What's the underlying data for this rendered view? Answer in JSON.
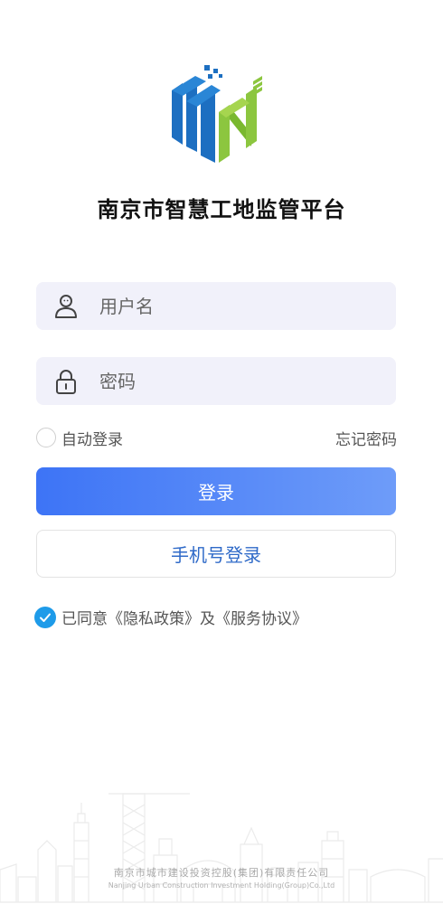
{
  "app": {
    "title": "南京市智慧工地监管平台"
  },
  "form": {
    "username_placeholder": "用户名",
    "password_placeholder": "密码",
    "remember_label": "自动登录",
    "forgot_label": "忘记密码",
    "login_label": "登录",
    "phone_login_label": "手机号登录"
  },
  "agreement": {
    "text": "已同意《隐私政策》及《服务协议》",
    "checked": true
  },
  "footer": {
    "company_cn": "南京市城市建设投资控股(集团)有限责任公司",
    "company_en": "Nanjing Urban Construction Investment Holding(Group)Co.,Ltd"
  },
  "colors": {
    "primary": "#3d74f6",
    "logo_blue": "#1d6fc1",
    "logo_green": "#8cc63f",
    "check": "#1e9be9"
  },
  "icons": [
    "logo",
    "user-icon",
    "lock-icon",
    "check-icon"
  ]
}
